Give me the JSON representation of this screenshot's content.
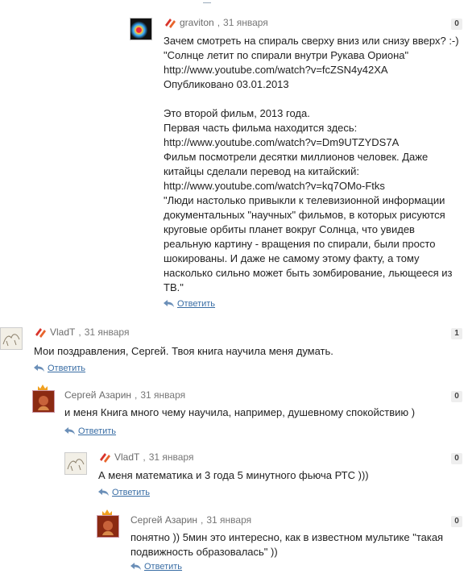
{
  "reply_label": "Ответить",
  "comments": [
    {
      "author": "graviton",
      "date": "31 января",
      "count": "0",
      "lines": [
        "Зачем смотреть на спираль сверху вниз или снизу вверх? :-)",
        "\"Солнце летит по спирали внутри Рукава Ориона\"",
        "http://www.youtube.com/watch?v=fcZSN4y42XA",
        "Опубликовано 03.01.2013",
        "",
        "Это второй фильм, 2013 года.",
        "Первая часть фильма находится здесь:",
        "http://www.youtube.com/watch?v=Dm9UTZYDS7A",
        "Фильм посмотрели десятки миллионов человек. Даже",
        "китайцы сделали перевод на китайский:",
        "http://www.youtube.com/watch?v=kq7OMo-Ftks",
        "\"Люди настолько привыкли к телевизионной информации",
        "документальных \"научных\" фильмов, в которых рисуются",
        "круговые орбиты планет вокруг Солнца, что увидев",
        "реальную картину - вращения по спирали, были просто",
        "шокированы. И даже не самому этому факту, а тому",
        "насколько сильно может быть зомбирование, льющееся из",
        "ТВ.\""
      ]
    },
    {
      "author": "VladT",
      "date": "31 января",
      "count": "1",
      "lines": [
        "Мои поздравления, Сергей. Твоя книга научила меня думать."
      ]
    },
    {
      "author": "Сергей Азарин",
      "date": "31 января",
      "count": "0",
      "lines": [
        "и меня Книга много чему научила, например, душевному спокойствию )"
      ]
    },
    {
      "author": "VladT",
      "date": "31 января",
      "count": "0",
      "lines": [
        "А меня математика и 3 года 5 минутного фьюча РТС )))"
      ]
    },
    {
      "author": "Сергей Азарин",
      "date": "31 января",
      "count": "0",
      "lines": [
        "понятно )) 5мин это интересно, как в известном мультике \"такая",
        "подвижность образовалась\" ))"
      ]
    }
  ]
}
